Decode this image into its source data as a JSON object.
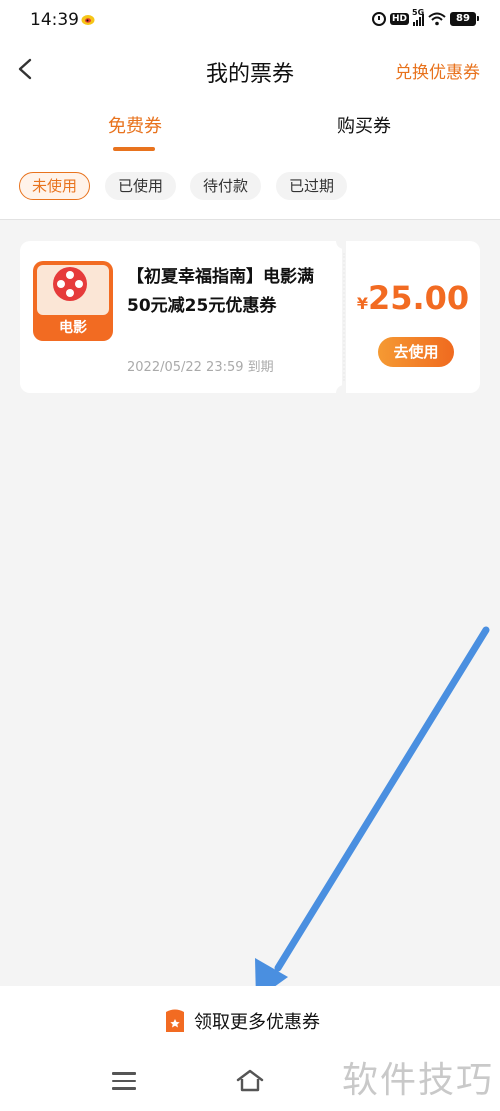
{
  "status_bar": {
    "time": "14:39",
    "network": "5G",
    "battery": "89"
  },
  "header": {
    "title": "我的票券",
    "action": "兑换优惠券"
  },
  "tabs": [
    {
      "label": "免费券",
      "active": true
    },
    {
      "label": "购买券",
      "active": false
    }
  ],
  "filters": [
    {
      "label": "未使用",
      "active": true
    },
    {
      "label": "已使用",
      "active": false
    },
    {
      "label": "待付款",
      "active": false
    },
    {
      "label": "已过期",
      "active": false
    }
  ],
  "coupons": [
    {
      "icon_label": "电影",
      "title": "【初夏幸福指南】电影满50元减25元优惠券",
      "expiry": "2022/05/22 23:59 到期",
      "currency": "¥",
      "amount": "25.00",
      "button": "去使用"
    }
  ],
  "footer": {
    "more_coupons": "领取更多优惠券"
  },
  "watermark": "软件技巧",
  "colors": {
    "accent": "#e8731e",
    "background": "#f4f4f4",
    "annotation_arrow": "#4a8fe0"
  },
  "icons": [
    "back-arrow-icon",
    "movie-reel-icon",
    "ticket-icon",
    "menu-icon",
    "home-icon"
  ]
}
